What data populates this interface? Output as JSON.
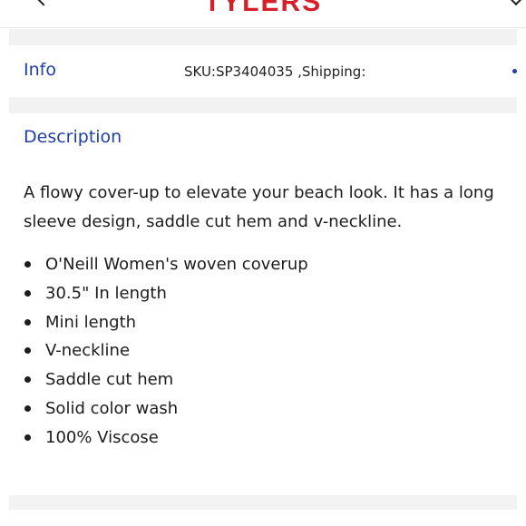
{
  "header": {
    "logo_text": "TYLERS",
    "back_icon": "chevron-left-icon",
    "brand_color": "#d62027"
  },
  "info": {
    "label": "Info",
    "sku_text": "SKU:SP3404035 ,Shipping:"
  },
  "description": {
    "title": "Description",
    "text": "A flowy cover-up to elevate your beach look. It has a long sleeve design, saddle cut hem and v-neckline.",
    "features": [
      "O'Neill Women's woven coverup",
      "30.5\" In length",
      "Mini length",
      "V-neckline",
      "Saddle cut hem",
      "Solid color wash",
      "100% Viscose"
    ]
  },
  "colors": {
    "accent": "#1f3fa6",
    "band": "#f2f2f2",
    "text": "#1c1c1c"
  }
}
